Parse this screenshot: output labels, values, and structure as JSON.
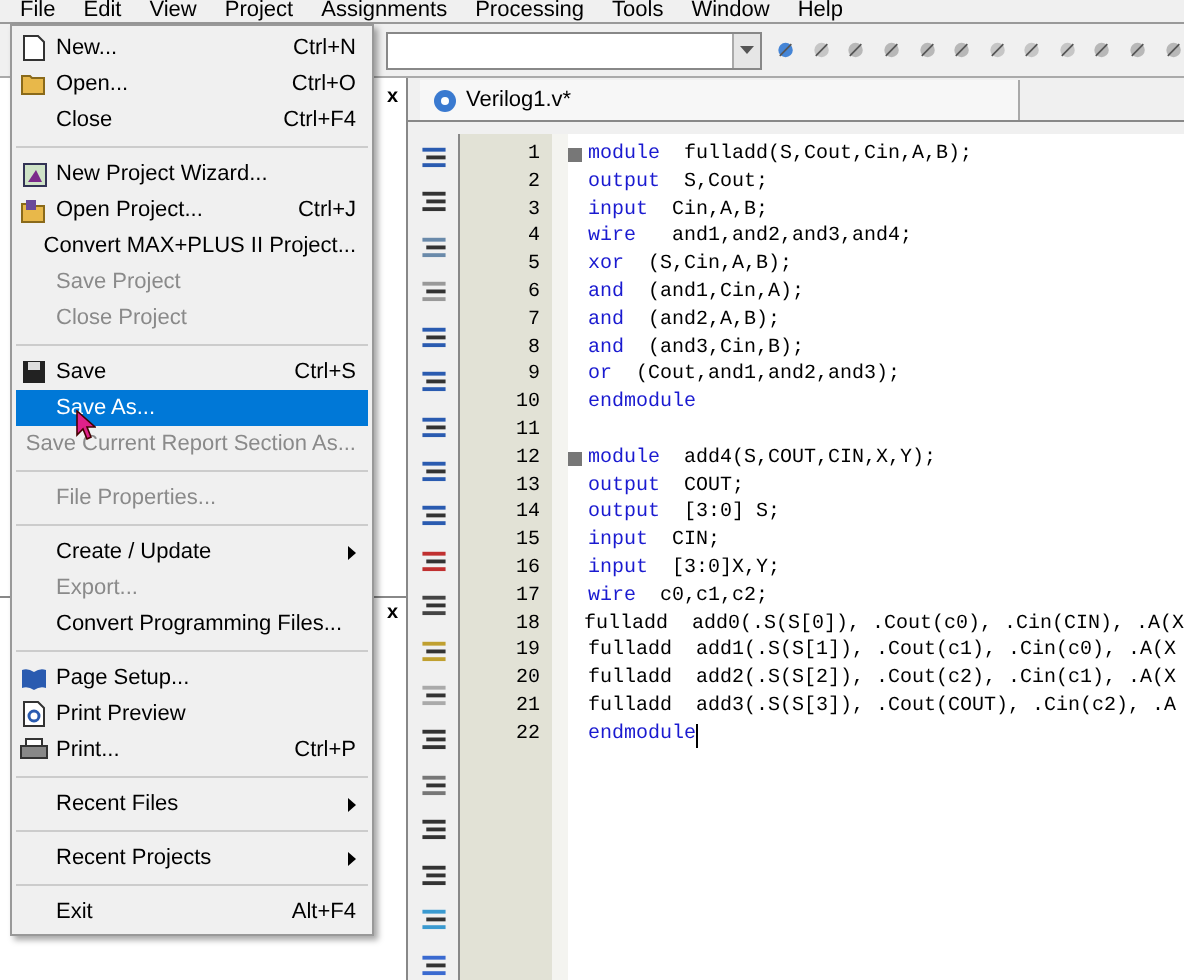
{
  "menubar": [
    "File",
    "Edit",
    "View",
    "Project",
    "Assignments",
    "Processing",
    "Tools",
    "Window",
    "Help"
  ],
  "file_menu": [
    {
      "kind": "item",
      "label": "New...",
      "shortcut": "Ctrl+N",
      "disabled": false,
      "submenu": false,
      "selected": false
    },
    {
      "kind": "item",
      "label": "Open...",
      "shortcut": "Ctrl+O",
      "disabled": false,
      "submenu": false,
      "selected": false
    },
    {
      "kind": "item",
      "label": "Close",
      "shortcut": "Ctrl+F4",
      "disabled": false,
      "submenu": false,
      "selected": false
    },
    {
      "kind": "separator"
    },
    {
      "kind": "item",
      "label": "New Project Wizard...",
      "disabled": false,
      "submenu": false,
      "selected": false
    },
    {
      "kind": "item",
      "label": "Open Project...",
      "shortcut": "Ctrl+J",
      "disabled": false,
      "submenu": false,
      "selected": false
    },
    {
      "kind": "item",
      "label": "Convert MAX+PLUS II Project...",
      "disabled": false,
      "submenu": false,
      "selected": false
    },
    {
      "kind": "item",
      "label": "Save Project",
      "disabled": true,
      "submenu": false,
      "selected": false
    },
    {
      "kind": "item",
      "label": "Close Project",
      "disabled": true,
      "submenu": false,
      "selected": false
    },
    {
      "kind": "separator"
    },
    {
      "kind": "item",
      "label": "Save",
      "shortcut": "Ctrl+S",
      "disabled": false,
      "submenu": false,
      "selected": false
    },
    {
      "kind": "item",
      "label": "Save As...",
      "disabled": false,
      "submenu": false,
      "selected": true
    },
    {
      "kind": "item",
      "label": "Save Current Report Section As...",
      "disabled": true,
      "submenu": false,
      "selected": false
    },
    {
      "kind": "separator"
    },
    {
      "kind": "item",
      "label": "File Properties...",
      "disabled": true,
      "submenu": false,
      "selected": false
    },
    {
      "kind": "separator"
    },
    {
      "kind": "item",
      "label": "Create / Update",
      "disabled": false,
      "submenu": true,
      "selected": false
    },
    {
      "kind": "item",
      "label": "Export...",
      "disabled": true,
      "submenu": false,
      "selected": false
    },
    {
      "kind": "item",
      "label": "Convert Programming Files...",
      "disabled": false,
      "submenu": false,
      "selected": false
    },
    {
      "kind": "separator"
    },
    {
      "kind": "item",
      "label": "Page Setup...",
      "disabled": false,
      "submenu": false,
      "selected": false
    },
    {
      "kind": "item",
      "label": "Print Preview",
      "disabled": false,
      "submenu": false,
      "selected": false
    },
    {
      "kind": "item",
      "label": "Print...",
      "shortcut": "Ctrl+P",
      "disabled": false,
      "submenu": false,
      "selected": false
    },
    {
      "kind": "separator"
    },
    {
      "kind": "item",
      "label": "Recent Files",
      "disabled": false,
      "submenu": true,
      "selected": false
    },
    {
      "kind": "separator"
    },
    {
      "kind": "item",
      "label": "Recent Projects",
      "disabled": false,
      "submenu": true,
      "selected": false
    },
    {
      "kind": "separator"
    },
    {
      "kind": "item",
      "label": "Exit",
      "shortcut": "Alt+F4",
      "disabled": false,
      "submenu": false,
      "selected": false
    }
  ],
  "panel_close_marks": [
    "x",
    "x"
  ],
  "editor": {
    "tab": "Verilog1.v*",
    "lines": [
      {
        "number": "1",
        "fold": true,
        "keyword": "module",
        "text": "  fulladd(S,Cout,Cin,A,B);"
      },
      {
        "number": "2",
        "fold": false,
        "keyword": "output",
        "text": "  S,Cout;"
      },
      {
        "number": "3",
        "fold": false,
        "keyword": "input",
        "text": "  Cin,A,B;"
      },
      {
        "number": "4",
        "fold": false,
        "keyword": "wire",
        "text": "   and1,and2,and3,and4;"
      },
      {
        "number": "5",
        "fold": false,
        "keyword": "xor",
        "text": "  (S,Cin,A,B);"
      },
      {
        "number": "6",
        "fold": false,
        "keyword": "and",
        "text": "  (and1,Cin,A);"
      },
      {
        "number": "7",
        "fold": false,
        "keyword": "and",
        "text": "  (and2,A,B);"
      },
      {
        "number": "8",
        "fold": false,
        "keyword": "and",
        "text": "  (and3,Cin,B);"
      },
      {
        "number": "9",
        "fold": false,
        "keyword": "or",
        "text": "  (Cout,and1,and2,and3);"
      },
      {
        "number": "10",
        "fold": false,
        "keyword": "endmodule"
      },
      {
        "number": "11",
        "fold": false
      },
      {
        "number": "12",
        "fold": true,
        "keyword": "module",
        "text": "  add4(S,COUT,CIN,X,Y);"
      },
      {
        "number": "13",
        "fold": false,
        "keyword": "output",
        "text": "  COUT;"
      },
      {
        "number": "14",
        "fold": false,
        "keyword": "output",
        "text": "  [3:0] S;"
      },
      {
        "number": "15",
        "fold": false,
        "keyword": "input",
        "text": "  CIN;"
      },
      {
        "number": "16",
        "fold": false,
        "keyword": "input",
        "text": "  [3:0]X,Y;"
      },
      {
        "number": "17",
        "fold": false,
        "keyword": "wire",
        "text": "  c0,c1,c2;"
      },
      {
        "number": "18",
        "fold": false,
        "text": "fulladd  add0(.S(S[0]), .Cout(c0), .Cin(CIN), .A(X"
      },
      {
        "number": "19",
        "fold": false,
        "text": "fulladd  add1(.S(S[1]), .Cout(c1), .Cin(c0), .A(X"
      },
      {
        "number": "20",
        "fold": false,
        "text": "fulladd  add2(.S(S[2]), .Cout(c2), .Cin(c1), .A(X"
      },
      {
        "number": "21",
        "fold": false,
        "text": "fulladd  add3(.S(S[3]), .Cout(COUT), .Cin(c2), .A"
      },
      {
        "number": "22",
        "fold": false,
        "keyword": "endmodule",
        "cursor": true
      }
    ]
  }
}
